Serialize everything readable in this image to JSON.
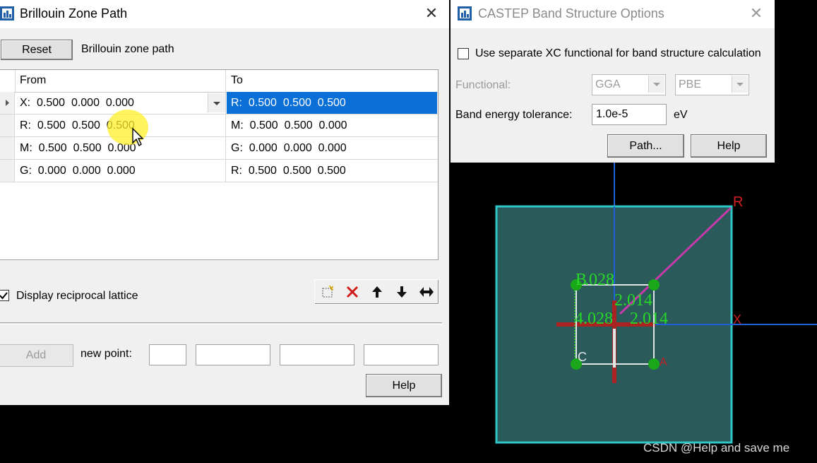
{
  "bz": {
    "title": "Brillouin Zone Path",
    "reset_label": "Reset",
    "path_label": "Brillouin zone path",
    "columns": [
      "From",
      "To"
    ],
    "rows": [
      {
        "from": "X:  0.500  0.000  0.000",
        "to": "R:  0.500  0.500  0.500"
      },
      {
        "from": "R:  0.500  0.500  0.500",
        "to": "M:  0.500  0.500  0.000"
      },
      {
        "from": "M:  0.500  0.500  0.000",
        "to": "G:  0.000  0.000  0.000"
      },
      {
        "from": "G:  0.000  0.000  0.000",
        "to": "R:  0.500  0.500  0.500"
      }
    ],
    "display_lattice_label": "Display reciprocal lattice",
    "display_lattice_checked": true,
    "add_label": "Add",
    "new_point_label": "new point:",
    "help_label": "Help"
  },
  "castep": {
    "title": "CASTEP Band Structure Options",
    "separate_xc_label": "Use separate XC functional for band structure calculation",
    "functional_label": "Functional:",
    "functional_value": "GGA",
    "functional_sub_value": "PBE",
    "tolerance_label": "Band energy tolerance:",
    "tolerance_value": "1.0e-5",
    "tolerance_unit": "eV",
    "path_button": "Path...",
    "help_button": "Help"
  },
  "viewer": {
    "labels": {
      "r_corner": "R",
      "x_axis": "X",
      "b_label": "B",
      "v1": ".028",
      "v2": "2.014",
      "v3": "4.028",
      "v4": "2.014",
      "c_label": "C",
      "a_label": "A"
    },
    "colors": {
      "box": "#2ec6c6",
      "fill": "#2a5a5a",
      "text": "#27d827",
      "axis": "#1f5fd8",
      "path": "#c43aa8"
    }
  },
  "watermark": "CSDN @Help and save me"
}
